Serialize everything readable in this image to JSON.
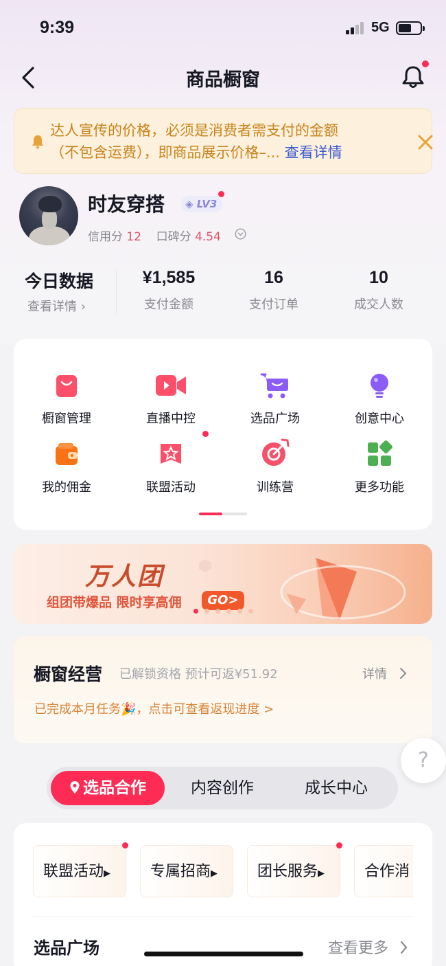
{
  "status_bar": {
    "time": "9:39",
    "network": "5G"
  },
  "nav": {
    "title": "商品橱窗"
  },
  "notice": {
    "line1": "达人宣传的价格，必须是消费者需支付的金额",
    "line2": "（不包含运费），即商品展示价格–...",
    "link": "查看详情"
  },
  "profile": {
    "name": "时友穿搭",
    "level": "LV3",
    "credit_label": "信用分",
    "credit_value": "12",
    "rep_label": "口碑分",
    "rep_value": "4.54"
  },
  "stats": {
    "title": "今日数据",
    "link": "查看详情 ›",
    "items": [
      {
        "value": "¥1,585",
        "label": "支付金额"
      },
      {
        "value": "16",
        "label": "支付订单"
      },
      {
        "value": "10",
        "label": "成交人数"
      }
    ]
  },
  "functions": [
    {
      "label": "橱窗管理",
      "icon": "bag-icon"
    },
    {
      "label": "直播中控",
      "icon": "video-camera-icon"
    },
    {
      "label": "选品广场",
      "icon": "cart-icon"
    },
    {
      "label": "创意中心",
      "icon": "lightbulb-icon"
    },
    {
      "label": "我的佣金",
      "icon": "wallet-icon"
    },
    {
      "label": "联盟活动",
      "icon": "star-badge-icon"
    },
    {
      "label": "训练营",
      "icon": "target-icon"
    },
    {
      "label": "更多功能",
      "icon": "grid-icon"
    }
  ],
  "banner": {
    "title": "万人团",
    "subtitle": "组团带爆品 限时享高佣",
    "cta": "GO>"
  },
  "operations": {
    "title": "橱窗经营",
    "subtitle": "已解锁资格 预计可返¥51.92",
    "detail": "详情",
    "progress": "已完成本月任务🎉，点击可查看返现进度 >"
  },
  "help": {
    "label": "?"
  },
  "tabs": [
    "选品合作",
    "内容创作",
    "成长中心"
  ],
  "chips": [
    "联盟活动",
    "专属招商",
    "团长服务",
    "合作消"
  ],
  "section": {
    "title": "选品广场",
    "more": "查看更多"
  },
  "colors": {
    "accent": "#fe2c55",
    "notice_text": "#c8841c",
    "link": "#3a5ad2"
  }
}
